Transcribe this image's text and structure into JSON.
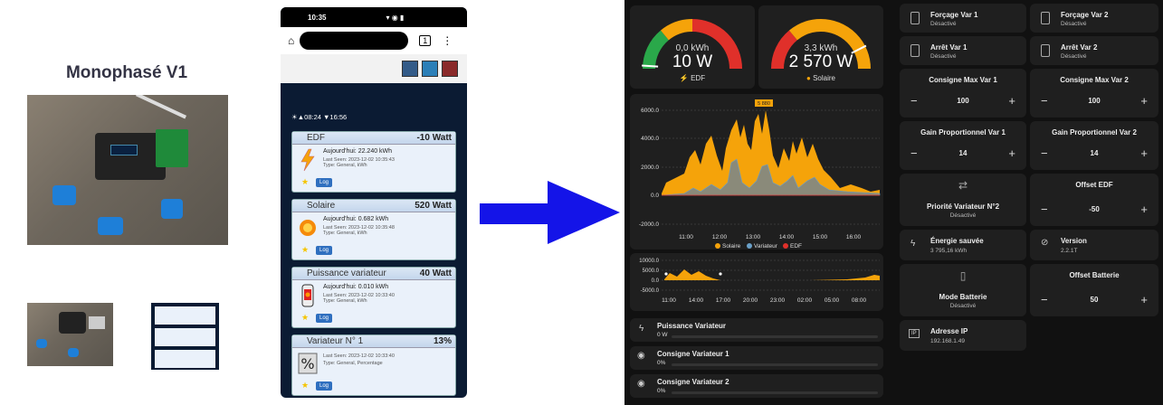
{
  "left": {
    "title": "Monophasé V1"
  },
  "phone": {
    "status_time": "10:35",
    "sun_times": "☀▲08:24 ▼16:56",
    "cards": [
      {
        "title": "EDF",
        "value": "-10 Watt",
        "today": "Aujourd'hui: 22.240 kWh",
        "seen": "Last Seen: 2023-12-02 10:35:43",
        "type": "Type: General, kWh",
        "log": "Log",
        "icon": "lightning-icon"
      },
      {
        "title": "Solaire",
        "value": "520 Watt",
        "today": "Aujourd'hui: 0.682 kWh",
        "seen": "Last Seen: 2023-12-02 10:35:48",
        "type": "Type: General, kWh",
        "log": "Log",
        "icon": "sun-icon"
      },
      {
        "title": "Puissance variateur",
        "value": "40 Watt",
        "today": "Aujourd'hui: 0.010 kWh",
        "seen": "Last Seen: 2023-12-02 10:33:40",
        "type": "Type: General, kWh",
        "log": "Log",
        "icon": "heater-icon"
      },
      {
        "title": "Variateur N° 1",
        "value": "13%",
        "today": "",
        "seen": "Last Seen: 2023-12-02 10:33:40",
        "type": "Type: General, Percentage",
        "log": "Log",
        "icon": "percent-icon"
      }
    ]
  },
  "dashboard": {
    "gauge_edf": {
      "kwh": "0,0 kWh",
      "watts": "10 W",
      "label": "EDF",
      "level": 0.02
    },
    "gauge_solar": {
      "kwh": "3,3 kWh",
      "watts": "2 570 W",
      "label": "Solaire",
      "level": 0.85
    },
    "chart_main": {
      "yticks": [
        "6000.0",
        "4000.0",
        "2000.0",
        "0.0",
        "-2000.0"
      ],
      "xticks": [
        "11:00",
        "12:00",
        "13:00",
        "14:00",
        "15:00",
        "16:00"
      ],
      "peak_label": "5 880",
      "legend": [
        "Solaire",
        "Variateur",
        "EDF"
      ]
    },
    "chart_small": {
      "yticks": [
        "10000.0",
        "5000.0",
        "0.0",
        "-5000.0"
      ],
      "xticks": [
        "11:00",
        "14:00",
        "17:00",
        "20:00",
        "23:00",
        "02:00",
        "05:00",
        "08:00"
      ]
    },
    "sensors": [
      {
        "name": "Puissance Variateur",
        "value": "0 W",
        "icon": "lightning-icon"
      },
      {
        "name": "Consigne Variateur 1",
        "value": "0%",
        "icon": "eye-icon"
      },
      {
        "name": "Consigne Variateur 2",
        "value": "0%",
        "icon": "eye-icon"
      }
    ],
    "tiles": {
      "forcage1": {
        "name": "Forçage Var 1",
        "state": "Désactivé"
      },
      "forcage2": {
        "name": "Forçage Var 2",
        "state": "Désactivé"
      },
      "arret1": {
        "name": "Arrêt Var 1",
        "state": "Désactivé"
      },
      "arret2": {
        "name": "Arrêt Var 2",
        "state": "Désactivé"
      },
      "cmax1": {
        "name": "Consigne Max Var 1",
        "value": "100"
      },
      "cmax2": {
        "name": "Consigne Max Var 2",
        "value": "100"
      },
      "gain1": {
        "name": "Gain Proportionnel Var 1",
        "value": "14"
      },
      "gain2": {
        "name": "Gain Proportionnel Var 2",
        "value": "14"
      },
      "prio": {
        "name": "Priorité Variateur N°2",
        "state": "Désactivé"
      },
      "offset_edf": {
        "name": "Offset EDF",
        "value": "-50"
      },
      "energie": {
        "name": "Énergie sauvée",
        "value": "3 795,16 kWh"
      },
      "version": {
        "name": "Version",
        "value": "2.2.1T"
      },
      "mode_batt": {
        "name": "Mode Batterie",
        "state": "Désactivé"
      },
      "offset_batt": {
        "name": "Offset Batterie",
        "value": "50"
      },
      "ip": {
        "name": "Adresse IP",
        "value": "192.168.1.49"
      }
    },
    "minus": "−",
    "plus": "+"
  },
  "colors": {
    "solar": "#f5a30a",
    "variateur": "#6aa0c8",
    "edf": "#e0302a",
    "green": "#2aa84a"
  }
}
